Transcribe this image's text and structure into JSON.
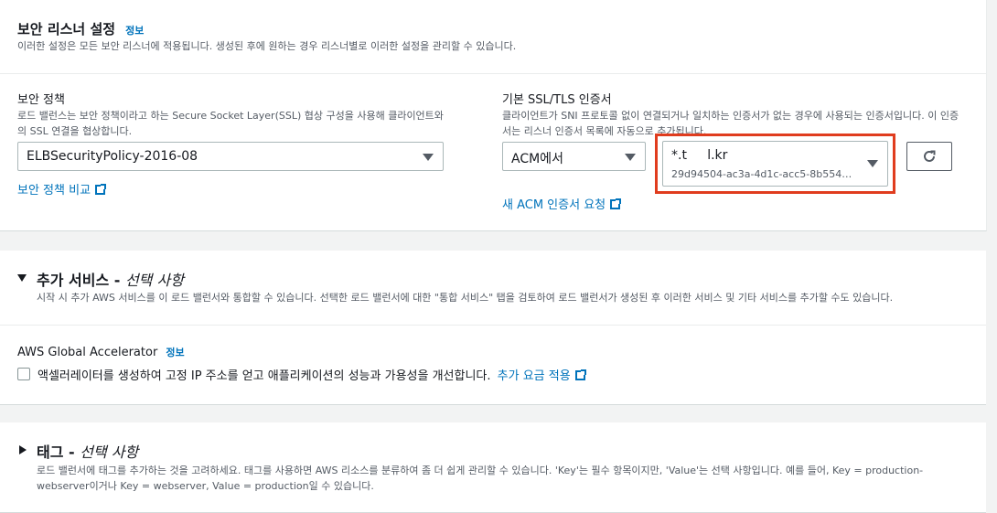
{
  "listener": {
    "title": "보안 리스너 설정",
    "info": "정보",
    "description": "이러한 설정은 모든 보안 리스너에 적용됩니다. 생성된 후에 원하는 경우 리스너별로 이러한 설정을 관리할 수 있습니다.",
    "policy": {
      "label": "보안 정책",
      "desc_line1": "로드 밸런스는 보안 정책이라고 하는 Secure Socket Layer(SSL) 협상 구성을 사용해 클라이언트와",
      "desc_line2": "의 SSL 연결을 협상합니다.",
      "selected": "ELBSecurityPolicy-2016-08",
      "compare_link": "보안 정책 비교"
    },
    "certificate": {
      "label": "기본 SSL/TLS 인증서",
      "desc_line1": "클라이언트가 SNI 프로토콜 없이 연결되거나 일치하는 인증서가 없는 경우에 사용되는 인증서입니다. 이 인증",
      "desc_line2": "서는 리스너 인증서 목록에 자동으로 추가됩니다.",
      "source": "ACM에서",
      "cert_name": "*.t     l.kr",
      "cert_id": "29d94504-ac3a-4d1c-acc5-8b554…",
      "request_link": "새 ACM 인증서 요청"
    }
  },
  "addons": {
    "title_main": "추가 서비스 - ",
    "title_optional": "선택 사항",
    "description": "시작 시 추가 AWS 서비스를 이 로드 밸런서와 통합할 수 있습니다. 선택한 로드 밸런서에 대한 \"통합 서비스\" 탭을 검토하여 로드 밸런서가 생성된 후 이러한 서비스 및 기타 서비스를 추가할 수도 있습니다.",
    "accelerator_label": "AWS Global Accelerator",
    "info": "정보",
    "checkbox_label": "액셀러레이터를 생성하여 고정 IP 주소를 얻고 애플리케이션의 성능과 가용성을 개선합니다.",
    "charges_link": "추가 요금 적용"
  },
  "tags": {
    "title_main": "태그 - ",
    "title_optional": "선택 사항",
    "desc_line1": "로드 밸런서에 태그를 추가하는 것을 고려하세요. 태그를 사용하면 AWS 리소스를 분류하여 좀 더 쉽게 관리할 수 있습니다. 'Key'는 필수 항목이지만, 'Value'는 선택 사항입니다. 예를 들어, Key = production-",
    "desc_line2": "webserver이거나 Key = webserver, Value = production일 수 있습니다."
  },
  "colors": {
    "link": "#0073bb",
    "highlight": "#e03c1e",
    "text": "#16191f",
    "muted": "#545b64"
  },
  "icons": [
    "external-link-icon",
    "refresh-icon",
    "caret-down-icon",
    "expand-triangle-icon"
  ]
}
